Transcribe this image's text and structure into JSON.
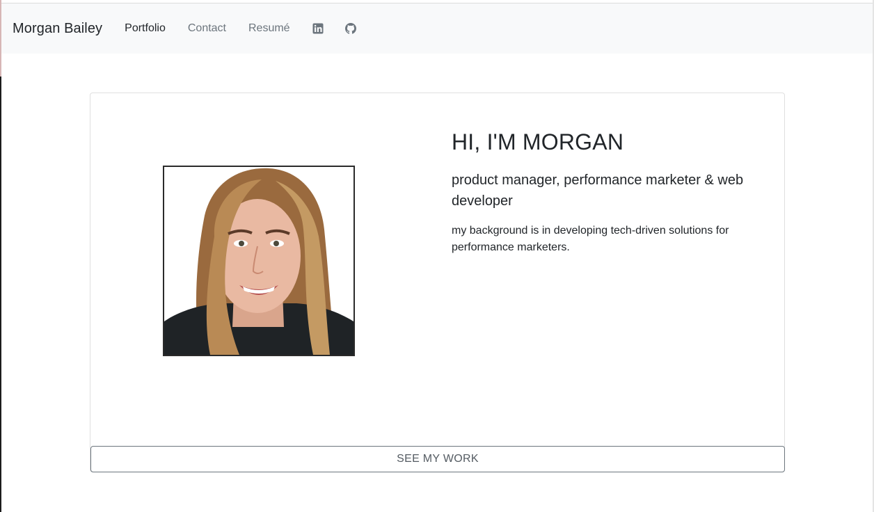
{
  "navbar": {
    "brand": "Morgan Bailey",
    "links": [
      {
        "label": "Portfolio",
        "active": true
      },
      {
        "label": "Contact",
        "active": false
      },
      {
        "label": "Resumé",
        "active": false
      }
    ],
    "icons": [
      "linkedin-icon",
      "github-icon"
    ]
  },
  "hero": {
    "title": "HI, I'M MORGAN",
    "subtitle": "product manager, performance marketer & web developer",
    "text": "my background is in developing tech-driven solutions for performance marketers.",
    "cta_label": "SEE MY WORK"
  },
  "colors": {
    "navbar_bg": "#f8f9fa",
    "text": "#212529",
    "muted": "#6c757d"
  }
}
